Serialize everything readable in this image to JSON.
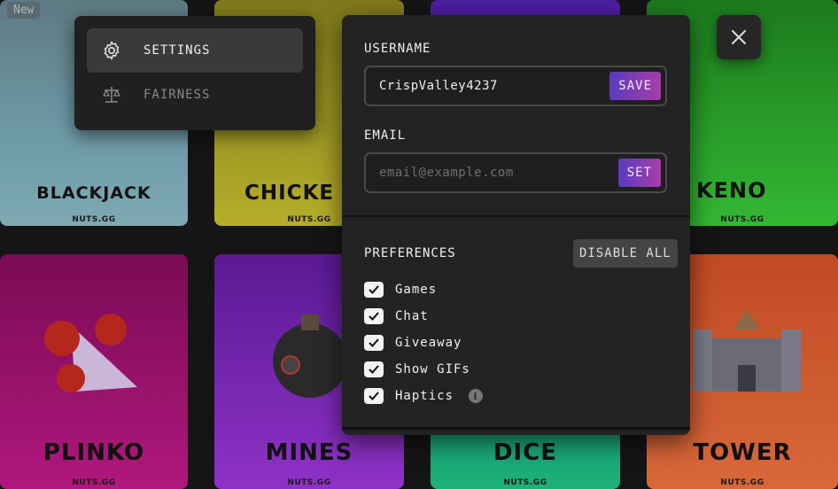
{
  "background": {
    "new_badge": "New",
    "brand": "NUTS.GG",
    "tiles": {
      "blackjack": "BLACKJACK",
      "chicken": "CHICKE",
      "keno": "KENO",
      "plinko": "PLINKO",
      "mines": "MINES",
      "dice": "DICE",
      "tower": "TOWER"
    }
  },
  "menu": {
    "settings": "SETTINGS",
    "fairness": "FAIRNESS"
  },
  "panel": {
    "username_label": "USERNAME",
    "username_value": "CrispValley4237",
    "save_label": "SAVE",
    "email_label": "EMAIL",
    "email_placeholder": "email@example.com",
    "set_label": "SET",
    "preferences_label": "PREFERENCES",
    "disable_all_label": "DISABLE ALL",
    "preferences": [
      {
        "label": "Games",
        "checked": true
      },
      {
        "label": "Chat",
        "checked": true
      },
      {
        "label": "Giveaway",
        "checked": true
      },
      {
        "label": "Show GIFs",
        "checked": true
      },
      {
        "label": "Haptics",
        "checked": true
      }
    ]
  },
  "icons": {
    "settings": "gear-icon",
    "fairness": "scale-icon",
    "close": "close-icon",
    "checkbox": "check-icon",
    "haptics_info": "info-icon"
  },
  "colors": {
    "accent_start": "#5a3bbf",
    "accent_end": "#a63ea8",
    "panel_bg": "#232323"
  }
}
